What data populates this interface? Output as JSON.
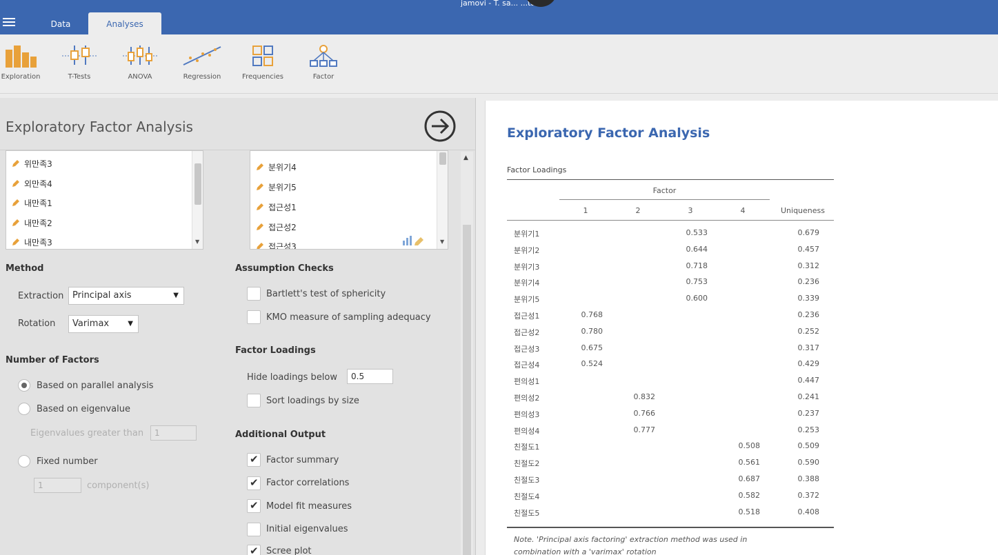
{
  "window": {
    "title": "jamovi - T. sa... ...ta",
    "tabs": [
      {
        "label": "Data",
        "active": false
      },
      {
        "label": "Analyses",
        "active": true
      }
    ]
  },
  "ribbon": [
    {
      "label": "Exploration",
      "icon": "exploration-icon"
    },
    {
      "label": "T-Tests",
      "icon": "t-tests-icon"
    },
    {
      "label": "ANOVA",
      "icon": "anova-icon"
    },
    {
      "label": "Regression",
      "icon": "regression-icon"
    },
    {
      "label": "Frequencies",
      "icon": "frequencies-icon"
    },
    {
      "label": "Factor",
      "icon": "factor-icon"
    }
  ],
  "options": {
    "title": "Exploratory Factor Analysis",
    "available_vars": [
      "위만족3",
      "외만족4",
      "내만족1",
      "내만족2",
      "내만족3"
    ],
    "selected_vars": [
      "분위기4",
      "분위기5",
      "접근성1",
      "접근성2",
      "접근성3"
    ],
    "method": {
      "heading": "Method",
      "extraction_label": "Extraction",
      "extraction_value": "Principal axis",
      "rotation_label": "Rotation",
      "rotation_value": "Varimax"
    },
    "nfactors": {
      "heading": "Number of Factors",
      "parallel": "Based on parallel analysis",
      "eigen": "Based on eigenvalue",
      "eigen_gt_label": "Eigenvalues greater than",
      "eigen_gt_value": "1",
      "fixed": "Fixed number",
      "fixed_value": "1",
      "component_label": "component(s)",
      "selected": "parallel"
    },
    "assumptions": {
      "heading": "Assumption Checks",
      "bartlett": "Bartlett's test of sphericity",
      "bartlett_checked": false,
      "kmo": "KMO measure of sampling adequacy",
      "kmo_checked": false
    },
    "loadings": {
      "heading": "Factor Loadings",
      "hide_label": "Hide loadings below",
      "hide_value": "0.5",
      "sort_label": "Sort loadings by size",
      "sort_checked": false
    },
    "additional": {
      "heading": "Additional Output",
      "items": [
        {
          "label": "Factor summary",
          "checked": true
        },
        {
          "label": "Factor correlations",
          "checked": true
        },
        {
          "label": "Model fit measures",
          "checked": true
        },
        {
          "label": "Initial eigenvalues",
          "checked": false
        },
        {
          "label": "Scree plot",
          "checked": true
        }
      ]
    }
  },
  "results": {
    "title": "Exploratory Factor Analysis",
    "table_title": "Factor Loadings",
    "factor_header": "Factor",
    "columns": [
      "1",
      "2",
      "3",
      "4",
      "Uniqueness"
    ],
    "rows": [
      {
        "label": "분위기1",
        "f1": "",
        "f2": "",
        "f3": "0.533",
        "f4": "",
        "u": "0.679"
      },
      {
        "label": "분위기2",
        "f1": "",
        "f2": "",
        "f3": "0.644",
        "f4": "",
        "u": "0.457"
      },
      {
        "label": "분위기3",
        "f1": "",
        "f2": "",
        "f3": "0.718",
        "f4": "",
        "u": "0.312"
      },
      {
        "label": "분위기4",
        "f1": "",
        "f2": "",
        "f3": "0.753",
        "f4": "",
        "u": "0.236"
      },
      {
        "label": "분위기5",
        "f1": "",
        "f2": "",
        "f3": "0.600",
        "f4": "",
        "u": "0.339"
      },
      {
        "label": "접근성1",
        "f1": "0.768",
        "f2": "",
        "f3": "",
        "f4": "",
        "u": "0.236"
      },
      {
        "label": "접근성2",
        "f1": "0.780",
        "f2": "",
        "f3": "",
        "f4": "",
        "u": "0.252"
      },
      {
        "label": "접근성3",
        "f1": "0.675",
        "f2": "",
        "f3": "",
        "f4": "",
        "u": "0.317"
      },
      {
        "label": "접근성4",
        "f1": "0.524",
        "f2": "",
        "f3": "",
        "f4": "",
        "u": "0.429"
      },
      {
        "label": "편의성1",
        "f1": "",
        "f2": "",
        "f3": "",
        "f4": "",
        "u": "0.447"
      },
      {
        "label": "편의성2",
        "f1": "",
        "f2": "0.832",
        "f3": "",
        "f4": "",
        "u": "0.241"
      },
      {
        "label": "편의성3",
        "f1": "",
        "f2": "0.766",
        "f3": "",
        "f4": "",
        "u": "0.237"
      },
      {
        "label": "편의성4",
        "f1": "",
        "f2": "0.777",
        "f3": "",
        "f4": "",
        "u": "0.253"
      },
      {
        "label": "친절도1",
        "f1": "",
        "f2": "",
        "f3": "",
        "f4": "0.508",
        "u": "0.509"
      },
      {
        "label": "친절도2",
        "f1": "",
        "f2": "",
        "f3": "",
        "f4": "0.561",
        "u": "0.590"
      },
      {
        "label": "친절도3",
        "f1": "",
        "f2": "",
        "f3": "",
        "f4": "0.687",
        "u": "0.388"
      },
      {
        "label": "친절도4",
        "f1": "",
        "f2": "",
        "f3": "",
        "f4": "0.582",
        "u": "0.372"
      },
      {
        "label": "친절도5",
        "f1": "",
        "f2": "",
        "f3": "",
        "f4": "0.518",
        "u": "0.408"
      }
    ],
    "note_line1": "Note. 'Principal axis factoring' extraction method was used in",
    "note_line2": "combination with a 'varimax' rotation"
  },
  "colors": {
    "accent_blue": "#3b67b0",
    "ribbon_orange": "#e8a13a",
    "ribbon_blue": "#5079c0"
  }
}
